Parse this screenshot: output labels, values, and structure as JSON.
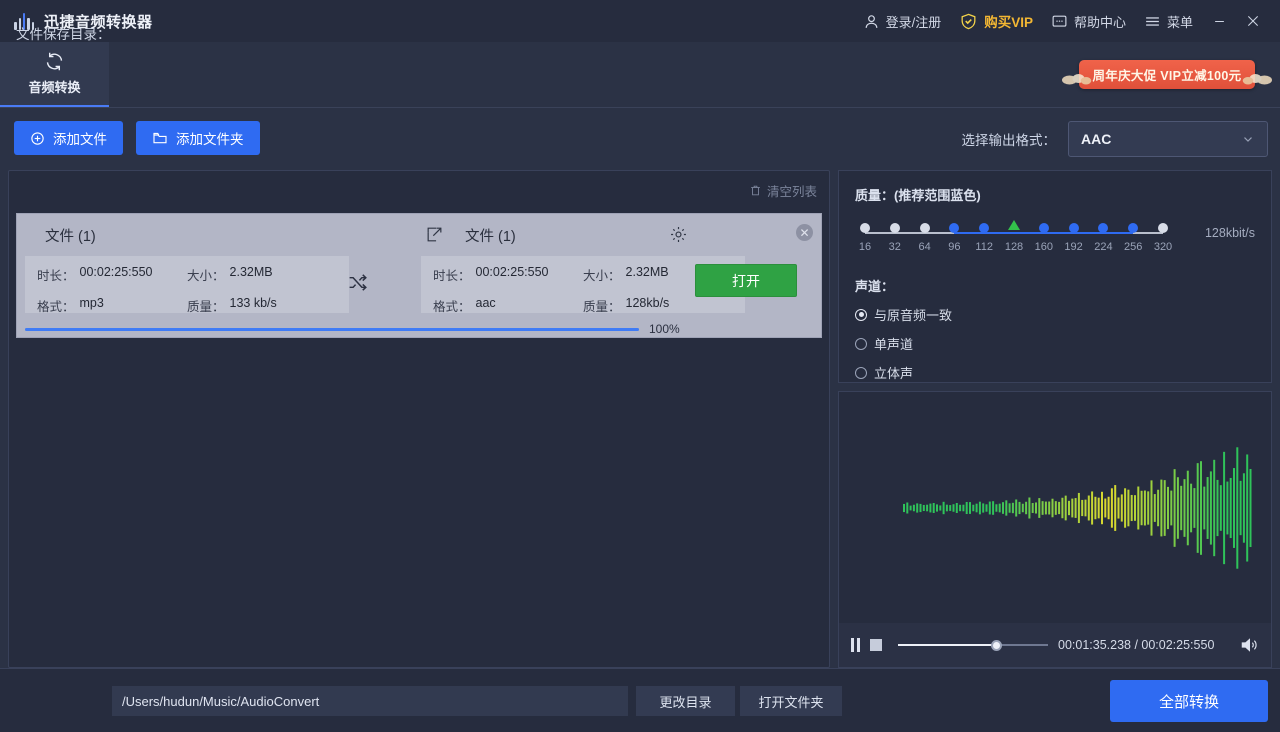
{
  "app": {
    "title": "迅捷音频转换器",
    "logo_icon": "audio-bars-logo-icon"
  },
  "titlebar": {
    "login": "登录/注册",
    "login_icon": "user-icon",
    "vip": "购买VIP",
    "vip_icon": "vip-shield-check-icon",
    "help": "帮助中心",
    "help_icon": "chat-bubble-icon",
    "menu": "菜单",
    "menu_icon": "hamburger-icon",
    "minimize_icon": "minimize-icon",
    "close_icon": "close-icon"
  },
  "tabs": [
    {
      "label": "音频转换",
      "icon": "convert-refresh-icon",
      "active": true
    }
  ],
  "promo": {
    "text": "周年庆大促 VIP立减100元",
    "color": "#e8553c"
  },
  "actions": {
    "add_file": "添加文件",
    "add_file_icon": "plus-circle-icon",
    "add_folder": "添加文件夹",
    "add_folder_icon": "folder-icon"
  },
  "output_format": {
    "label": "选择输出格式：",
    "value": "AAC",
    "chevron_icon": "chevron-down-icon"
  },
  "list_panel": {
    "clear_list": "清空列表",
    "clear_list_icon": "trash-icon",
    "files": [
      {
        "source": {
          "title": "文件 (1)",
          "duration_label": "时长：",
          "duration": "00:02:25:550",
          "size_label": "大小：",
          "size": "2.32MB",
          "format_label": "格式：",
          "format": "mp3",
          "quality_label": "质量：",
          "quality": "133 kb/s"
        },
        "target": {
          "title": "文件 (1)",
          "duration_label": "时长：",
          "duration": "00:02:25:550",
          "size_label": "大小：",
          "size": "2.32MB",
          "format_label": "格式：",
          "format": "aac",
          "quality_label": "质量：",
          "quality": "128kb/s"
        },
        "edit_icon": "edit-pencil-icon",
        "gear_icon": "gear-icon",
        "swap_icon": "shuffle-swap-icon",
        "close_icon": "close-x-icon",
        "open_button": "打开",
        "progress_percent": "100%",
        "progress_value": 100
      }
    ]
  },
  "settings": {
    "quality_title": "质量：(推荐范围蓝色)",
    "bitrate_readout": "128kbit/s",
    "quality_ticks": [
      "16",
      "32",
      "64",
      "96",
      "112",
      "128",
      "160",
      "192",
      "224",
      "256",
      "320"
    ],
    "recommended_from": "96",
    "recommended_to": "256",
    "selected_bitrate": "128",
    "channel_title": "声道：",
    "channels": [
      {
        "label": "与原音频一致",
        "selected": true
      },
      {
        "label": "单声道",
        "selected": false
      },
      {
        "label": "立体声",
        "selected": false
      }
    ]
  },
  "player": {
    "pause_icon": "pause-icon",
    "stop_icon": "stop-icon",
    "current_time": "00:01:35.238",
    "separator": " / ",
    "total_time": "00:02:25:550",
    "time_display": "00:01:35.238 / 00:02:25:550",
    "volume_icon": "volume-icon",
    "seek_percent": 65,
    "waveform_color_start": "#2fc35a",
    "waveform_color_mid": "#d8d92e"
  },
  "bottom": {
    "save_label": "文件保存目录：",
    "save_path": "/Users/hudun/Music/AudioConvert",
    "change_dir": "更改目录",
    "open_folder": "打开文件夹",
    "convert_all": "全部转换"
  }
}
